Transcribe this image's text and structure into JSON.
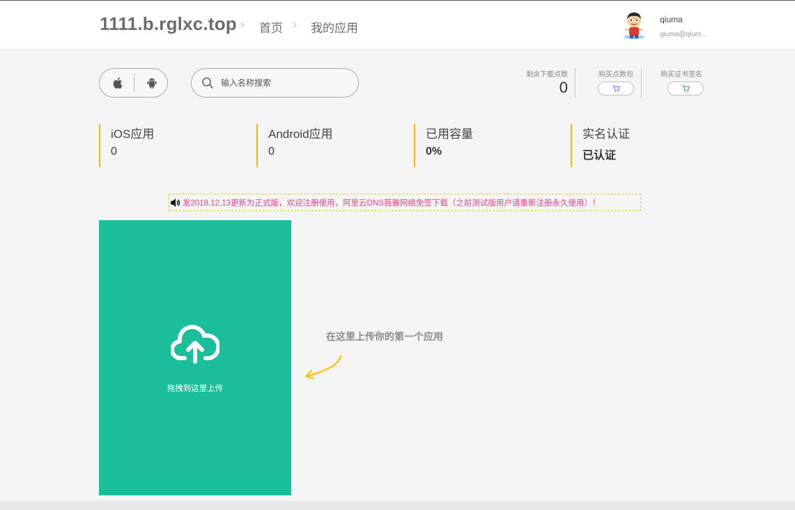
{
  "header": {
    "site_title": "1111.b.rglxc.top",
    "breadcrumb": [
      "首页",
      "我的应用"
    ],
    "separator": "›"
  },
  "user": {
    "name": "qiuma",
    "email": "qiuma@qium..."
  },
  "toolbar": {
    "platforms": [
      "apple-icon",
      "android-icon"
    ],
    "search_placeholder": "输入名称搜索",
    "search_value": ""
  },
  "account": {
    "points_label": "剩余下载点数",
    "points_value": "0",
    "buy_points_label": "购买点数包",
    "buy_cert_label": "购买证书签名"
  },
  "summary": [
    {
      "label": "iOS应用",
      "value": "0"
    },
    {
      "label": "Android应用",
      "value": "0"
    },
    {
      "label": "已用容量",
      "value": "0%"
    },
    {
      "label": "实名认证",
      "value": "已认证"
    }
  ],
  "notice": {
    "text": "发2018.12.13更新为正式版，欢迎注册使用，阿里云DNS薇雅网络免签下载（之前测试版用户请重新注册永久使用）！"
  },
  "upload": {
    "drop_label": "拖拽到这里上传",
    "hint": "在这里上传你的第一个应用"
  },
  "colors": {
    "accent_green": "#1bbe9b",
    "summary_bar": "#f5b400",
    "notice_text": "#e8428a",
    "hint_arrow": "#f5c518"
  }
}
